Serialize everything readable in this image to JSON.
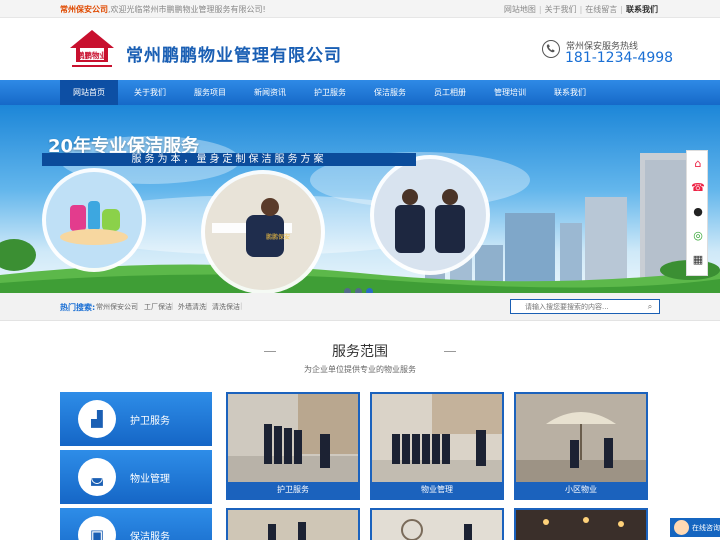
{
  "topbar": {
    "brand": "常州保安公司",
    "welcome": ",欢迎光临常州市鹏鹏物业管理服务有限公司!",
    "links": [
      "网站地图",
      "关于我们",
      "在线留言",
      "联系我们"
    ]
  },
  "header": {
    "logo_text": "鹏鹏物业",
    "company_name": "常州鹏鹏物业管理有限公司",
    "hotline_label": "常州保安服务热线",
    "hotline_number": "181-1234-4998"
  },
  "nav": {
    "items": [
      "网站首页",
      "关于我们",
      "服务项目",
      "新闻资讯",
      "护卫服务",
      "保洁服务",
      "员工相册",
      "管理培训",
      "联系我们"
    ],
    "active": "网站首页"
  },
  "banner": {
    "headline": "20年专业保洁服务",
    "tagline": "服务为本，量身定制保洁服务方案",
    "badge_text": "鹏鹏保安",
    "slide_count": 3
  },
  "hotbar": {
    "label": "热门搜索:",
    "keywords": [
      "常州保安公司",
      "工厂保洁",
      "外墙清洗",
      "清洗保洁"
    ],
    "search_placeholder": "请输入搜您要搜索的内容..."
  },
  "services": {
    "title": "服务范围",
    "subtitle": "为企业单位提供专业的物业服务",
    "side_items": [
      {
        "label": "护卫服务",
        "icon": "guard-booth-icon"
      },
      {
        "label": "物业管理",
        "icon": "shopping-bag-icon"
      },
      {
        "label": "保洁服务",
        "icon": "cleaning-machine-icon"
      }
    ],
    "tiles": [
      "护卫服务",
      "物业管理",
      "小区物业"
    ]
  },
  "consult": {
    "label": "在线咨询"
  },
  "colors": {
    "brand_blue": "#1a5fb4",
    "nav_blue": "#1669c8",
    "accent_orange": "#e04a00"
  }
}
